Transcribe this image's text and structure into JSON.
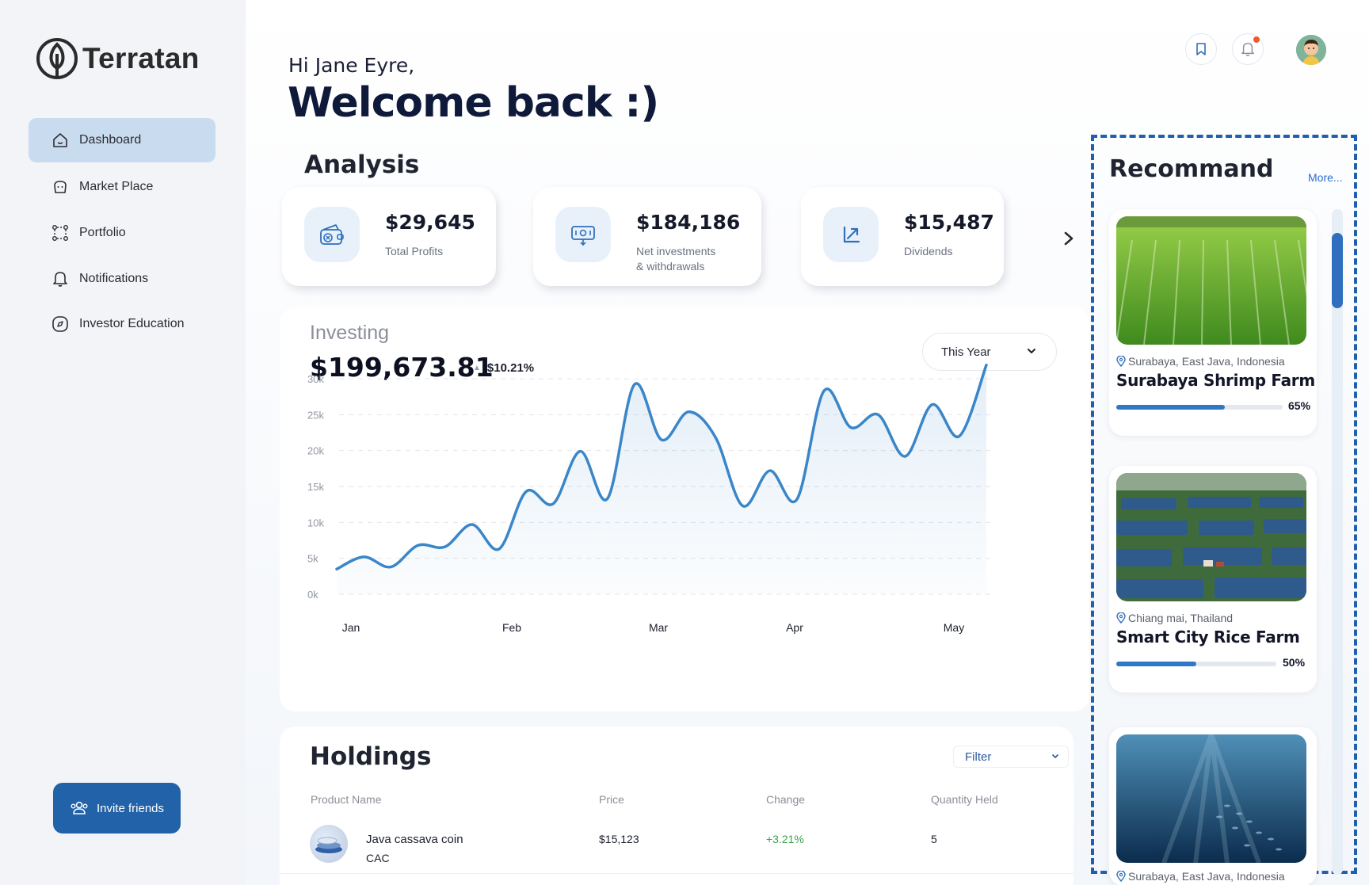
{
  "app": {
    "name": "Terratan"
  },
  "sidebar": {
    "items": [
      {
        "label": "Dashboard",
        "icon": "home-icon",
        "active": true
      },
      {
        "label": "Market Place",
        "icon": "basket-icon",
        "active": false
      },
      {
        "label": "Portfolio",
        "icon": "nodes-icon",
        "active": false
      },
      {
        "label": "Notifications",
        "icon": "bell-icon",
        "active": false
      },
      {
        "label": "Investor Education",
        "icon": "compass-icon",
        "active": false
      }
    ],
    "invite_label": "Invite friends"
  },
  "header": {
    "greeting": "Hi Jane Eyre,",
    "welcome": "Welcome back :)",
    "notification_dot_color": "#ef5a2a"
  },
  "analysis": {
    "title": "Analysis",
    "stats": [
      {
        "value": "$29,645",
        "label": "Total Profits",
        "icon": "wallet-icon"
      },
      {
        "value": "$184,186",
        "label_line1": "Net investments",
        "label_line2": "& withdrawals",
        "icon": "cash-icon"
      },
      {
        "value": "$15,487",
        "label": "Dividends",
        "icon": "arrow-up-right-icon"
      }
    ]
  },
  "investing": {
    "title": "Investing",
    "value": "$199,673.81",
    "change": "$10.21%",
    "period": "This Year"
  },
  "chart_data": {
    "type": "area",
    "x_labels": [
      "Jan",
      "Feb",
      "Mar",
      "Apr",
      "May"
    ],
    "y_ticks": [
      "30k",
      "25k",
      "20k",
      "15k",
      "10k",
      "5k",
      "0k"
    ],
    "ylim": [
      0,
      30000
    ],
    "grid": true,
    "accent": "#3a86c8",
    "series": [
      {
        "values": [
          3500,
          5200,
          3800,
          6800,
          6600,
          9700,
          6300,
          14300,
          12600,
          19900,
          13300,
          29200,
          21500,
          25400,
          21800,
          12300,
          17200,
          13200,
          28300,
          23200,
          25000,
          19200,
          26400,
          22000,
          31900
        ]
      }
    ]
  },
  "holdings": {
    "title": "Holdings",
    "filter_label": "Filter",
    "columns": [
      "Product Name",
      "Price",
      "Change",
      "Quantity Held"
    ],
    "rows": [
      {
        "name": "Java cassava coin",
        "ticker": "CAC",
        "price": "$15,123",
        "change": "+3.21%",
        "quantity": "5"
      }
    ],
    "positive_color": "#3aa34a"
  },
  "recommand": {
    "title": "Recommand",
    "more": "More...",
    "items": [
      {
        "location": "Surabaya, East Java, Indonesia",
        "name": "Surabaya Shrimp Farm",
        "progress": 65,
        "progress_label": "65%"
      },
      {
        "location": "Chiang mai, Thailand",
        "name": "Smart City Rice Farm",
        "progress": 50,
        "progress_label": "50%"
      },
      {
        "location": "Surabaya, East Java, Indonesia"
      }
    ]
  }
}
